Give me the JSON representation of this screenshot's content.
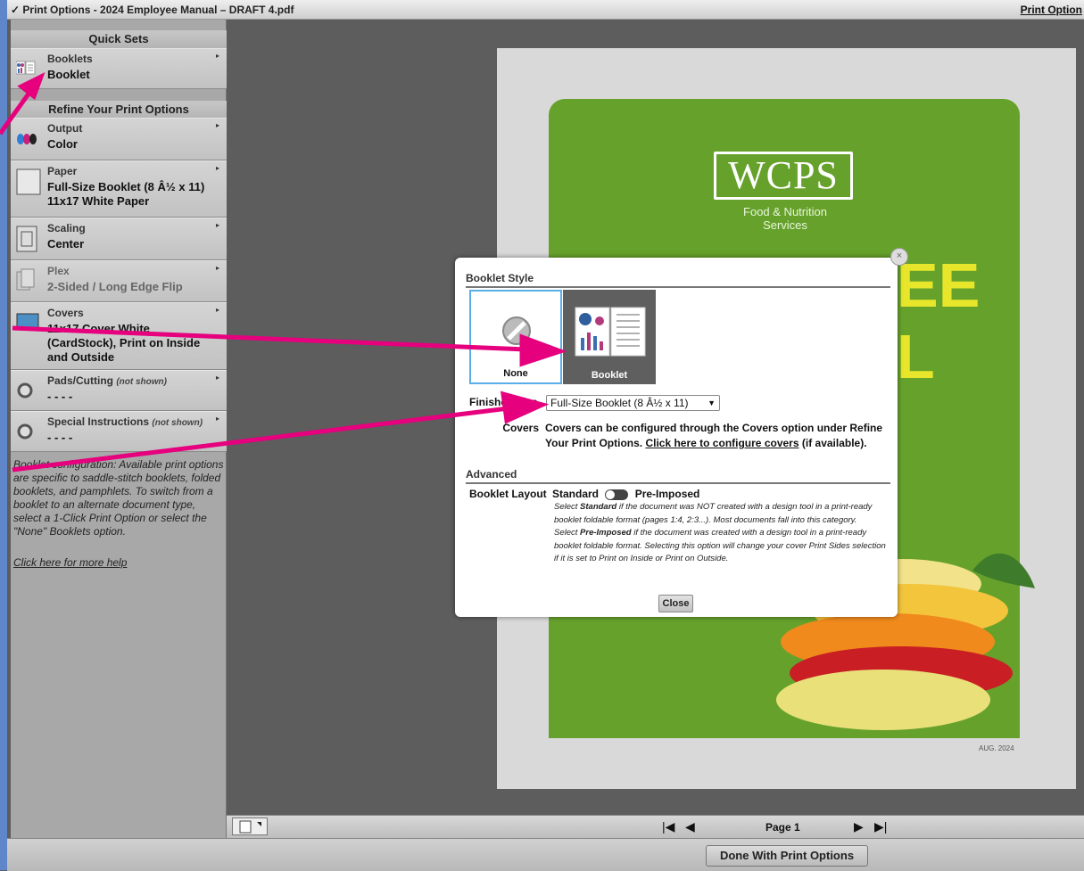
{
  "titlebar": {
    "title": "✓ Print Options - 2024 Employee Manual – DRAFT 4.pdf",
    "right_link": "Print Option"
  },
  "sidebar": {
    "quick_sets_header": "Quick Sets",
    "refine_header": "Refine Your Print Options",
    "booklets": {
      "label": "Booklets",
      "value": "Booklet"
    },
    "output": {
      "label": "Output",
      "value": "Color"
    },
    "paper": {
      "label": "Paper",
      "value": "Full-Size Booklet (8 Â½ x 11) 11x17 White Paper"
    },
    "scaling": {
      "label": "Scaling",
      "value": "Center"
    },
    "plex": {
      "label": "Plex",
      "value": "2-Sided / Long Edge Flip"
    },
    "covers": {
      "label": "Covers",
      "value": "11x17 Cover White (CardStock), Print on Inside and Outside"
    },
    "pads": {
      "label": "Pads/Cutting",
      "note": "(not shown)",
      "value": "- - - -"
    },
    "special": {
      "label": "Special Instructions",
      "note": "(not shown)",
      "value": "- - - -"
    },
    "help_text": "Booklet configuration: Available print options are specific to saddle-stitch booklets, folded booklets, and pamphlets. To switch from a booklet to an alternate document type, select a 1-Click Print Option or select the \"None\" Booklets option.",
    "help_link": "Click here for more help"
  },
  "preview": {
    "logo_text": "WCPS",
    "logo_subtitle": "Food & Nutrition Services",
    "big_text": "EE\nL",
    "date": "AUG. 2024"
  },
  "dialog": {
    "style_header": "Booklet Style",
    "tile_none": "None",
    "tile_booklet": "Booklet",
    "finished_size_label": "Finished Size",
    "finished_size_value": "Full-Size Booklet (8 Â½ x 11)",
    "covers_label": "Covers",
    "covers_text_1": "Covers can be configured through the Covers option under Refine Your Print Options.",
    "covers_link": "Click here to configure covers",
    "covers_text_2": "(if available).",
    "advanced_header": "Advanced",
    "layout_label": "Booklet Layout",
    "toggle_left": "Standard",
    "toggle_right": "Pre-Imposed",
    "desc_1a": "Select",
    "desc_1b": "Standard",
    "desc_1c": "if the document was NOT created with a design tool in a print-ready booklet foldable format (pages 1:4, 2:3...). Most documents fall into this category.",
    "desc_2a": "Select",
    "desc_2b": "Pre-Imposed",
    "desc_2c": "if the document was created with a design tool in a print-ready booklet foldable format. Selecting this option will change your cover Print Sides selection if it is set to Print on Inside or Print on Outside.",
    "close_label": "Close",
    "close_x": "×"
  },
  "bottombar": {
    "page_label": "Page 1",
    "first": "|◀",
    "prev": "◀",
    "next": "▶",
    "last": "▶|"
  },
  "footer": {
    "done_label": "Done With Print Options"
  },
  "colors": {
    "accent_arrow": "#e6007e",
    "cover_green": "#66a22b",
    "selected_tile": "#5aaee8"
  }
}
